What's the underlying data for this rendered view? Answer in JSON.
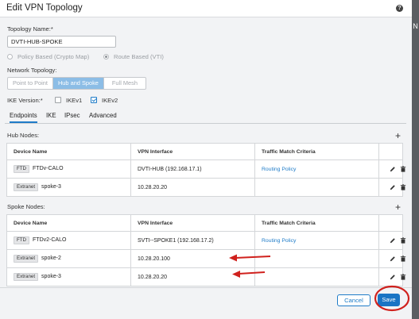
{
  "dialog": {
    "title": "Edit VPN Topology",
    "help_icon": "question-circle-icon"
  },
  "side_strip_letter": "N",
  "topology_name": {
    "label": "Topology Name:*",
    "value": "DVTI-HUB-SPOKE"
  },
  "vpn_type": {
    "policy_based": "Policy Based (Crypto Map)",
    "route_based": "Route Based (VTI)",
    "selected": "route_based"
  },
  "network_topology": {
    "label": "Network Topology:",
    "options": [
      "Point to Point",
      "Hub and Spoke",
      "Full Mesh"
    ],
    "selected": "Hub and Spoke"
  },
  "ike_version": {
    "label": "IKE Version:*",
    "ikev1": "IKEv1",
    "ikev2": "IKEv2",
    "ikev1_checked": false,
    "ikev2_checked": true
  },
  "tabs": [
    "Endpoints",
    "IKE",
    "IPsec",
    "Advanced"
  ],
  "active_tab": "Endpoints",
  "hub_nodes": {
    "label": "Hub Nodes:",
    "columns": [
      "Device Name",
      "VPN Interface",
      "Traffic Match Criteria"
    ],
    "rows": [
      {
        "badge": "FTD",
        "device": "FTDv-CALO",
        "interface": "DVTI-HUB (192.168.17.1)",
        "traffic": "Routing Policy"
      },
      {
        "badge": "Extranet",
        "device": "spoke-3",
        "interface": "10.28.20.20",
        "traffic": ""
      }
    ]
  },
  "spoke_nodes": {
    "label": "Spoke Nodes:",
    "columns": [
      "Device Name",
      "VPN Interface",
      "Traffic Match Criteria"
    ],
    "rows": [
      {
        "badge": "FTD",
        "device": "FTDv2-CALO",
        "interface": "SVTI--SPOKE1 (192.168.17.2)",
        "traffic": "Routing Policy"
      },
      {
        "badge": "Extranet",
        "device": "spoke-2",
        "interface": "10.28.20.100",
        "traffic": ""
      },
      {
        "badge": "Extranet",
        "device": "spoke-3",
        "interface": "10.28.20.20",
        "traffic": ""
      }
    ]
  },
  "footer": {
    "cancel": "Cancel",
    "save": "Save"
  },
  "colors": {
    "accent": "#1a74c4",
    "annotation": "#d0211d",
    "segment_active": "#8cbde6"
  }
}
